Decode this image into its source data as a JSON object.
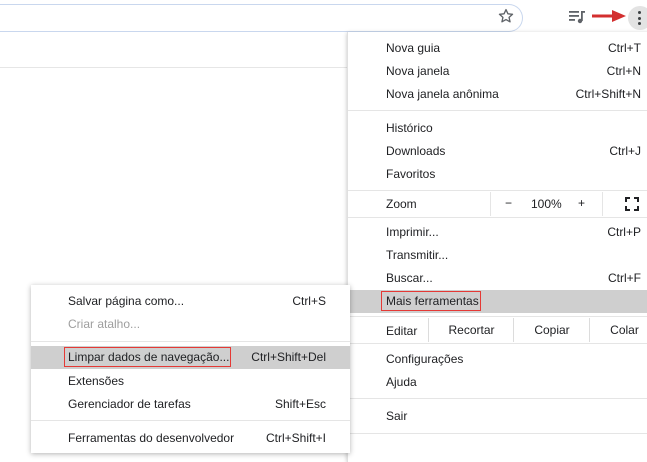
{
  "toolbar": {
    "icons": [
      "star-icon",
      "media-control-icon",
      "red-arrow",
      "kebab-menu-icon"
    ],
    "accent_color": "#d32f2f"
  },
  "menu": {
    "group1": [
      {
        "label": "Nova guia",
        "shortcut": "Ctrl+T"
      },
      {
        "label": "Nova janela",
        "shortcut": "Ctrl+N"
      },
      {
        "label": "Nova janela anônima",
        "shortcut": "Ctrl+Shift+N"
      }
    ],
    "group2": [
      {
        "label": "Histórico",
        "shortcut": ""
      },
      {
        "label": "Downloads",
        "shortcut": "Ctrl+J"
      },
      {
        "label": "Favoritos",
        "shortcut": ""
      }
    ],
    "zoom": {
      "label": "Zoom",
      "minus": "−",
      "value": "100%",
      "plus": "+"
    },
    "group3": [
      {
        "label": "Imprimir...",
        "shortcut": "Ctrl+P"
      },
      {
        "label": "Transmitir...",
        "shortcut": ""
      },
      {
        "label": "Buscar...",
        "shortcut": "Ctrl+F"
      },
      {
        "label": "Mais ferramentas",
        "shortcut": ""
      }
    ],
    "edit": {
      "label": "Editar",
      "cut": "Recortar",
      "copy": "Copiar",
      "paste": "Colar"
    },
    "group4": [
      {
        "label": "Configurações",
        "shortcut": ""
      },
      {
        "label": "Ajuda",
        "shortcut": ""
      }
    ],
    "exit": {
      "label": "Sair"
    }
  },
  "submenu": {
    "group1": [
      {
        "label": "Salvar página como...",
        "shortcut": "Ctrl+S"
      },
      {
        "label": "Criar atalho...",
        "shortcut": ""
      }
    ],
    "group2": [
      {
        "label": "Limpar dados de navegação...",
        "shortcut": "Ctrl+Shift+Del"
      },
      {
        "label": "Extensões",
        "shortcut": ""
      },
      {
        "label": "Gerenciador de tarefas",
        "shortcut": "Shift+Esc"
      }
    ],
    "group3": [
      {
        "label": "Ferramentas do desenvolvedor",
        "shortcut": "Ctrl+Shift+I"
      }
    ]
  }
}
